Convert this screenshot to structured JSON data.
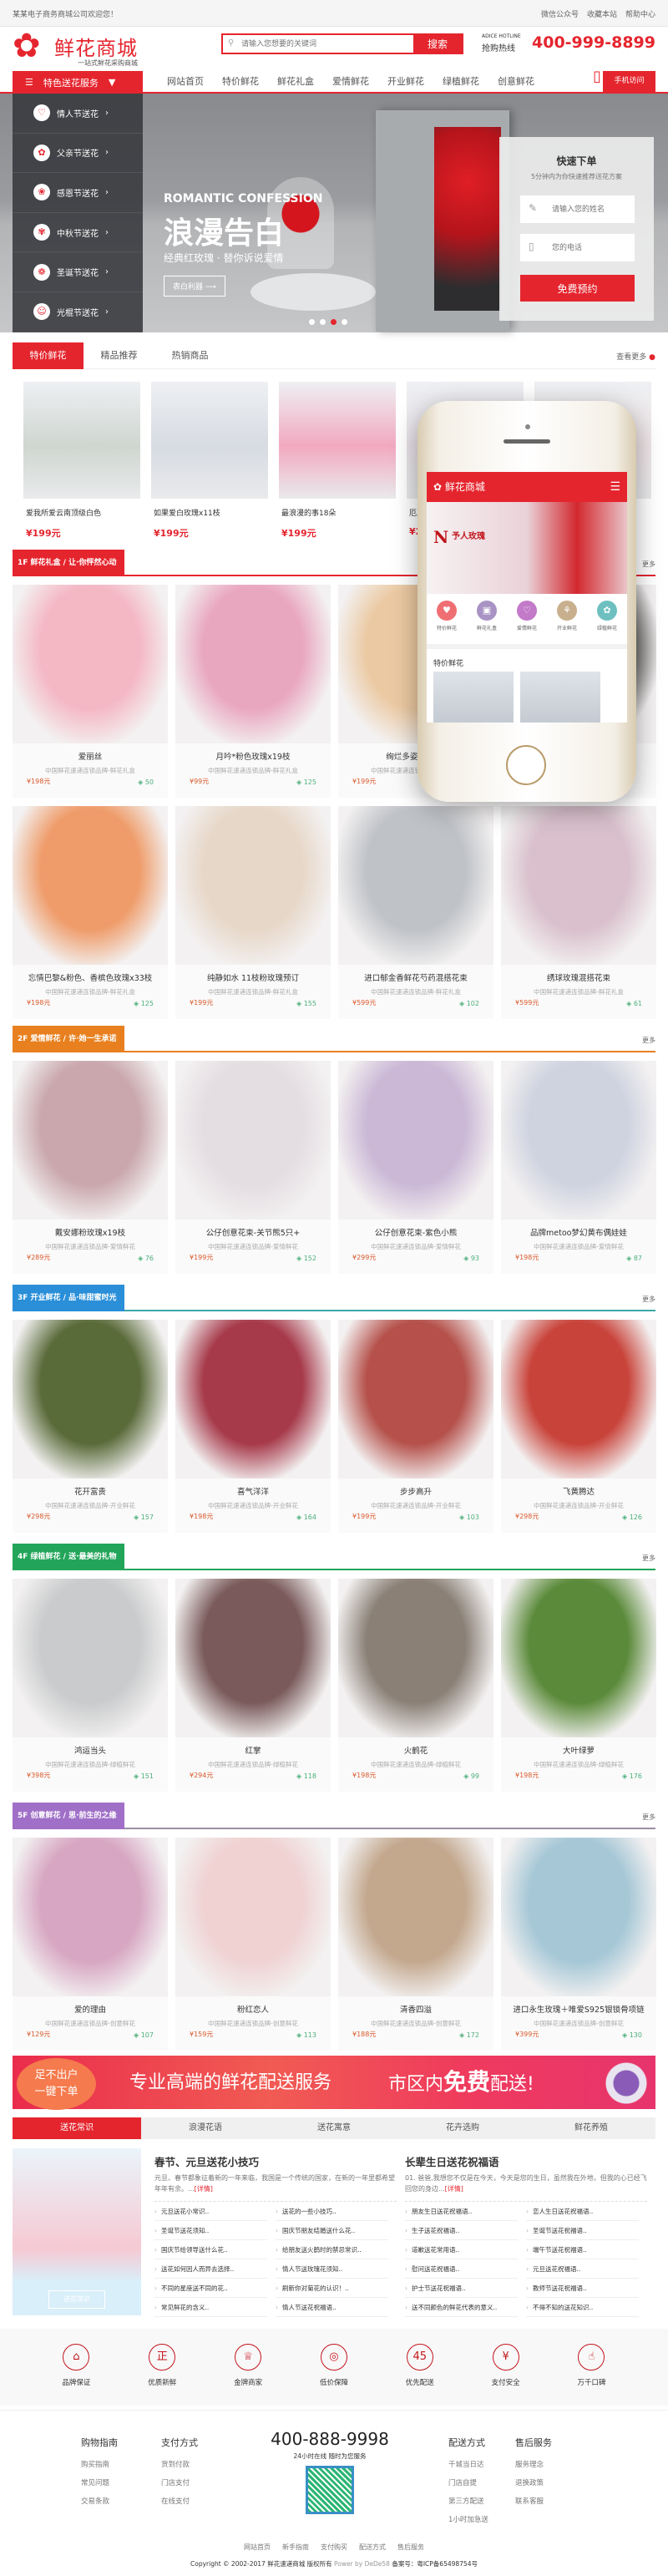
{
  "topbar": {
    "welcome": "某某电子商务商城公司欢迎您！",
    "links": [
      "微信公众号",
      "收藏本站",
      "帮助中心"
    ]
  },
  "header": {
    "logo_name": "鲜花商城",
    "logo_slogan": "一站式鲜花采购商城",
    "search_placeholder": "请输入您想要的关键词",
    "search_button": "搜索",
    "hotline_small": "ADICE HOTLINE",
    "hotline_label": "抢购热线",
    "hotline_number": "400-999-8899"
  },
  "nav": {
    "category_button": "特色送花服务",
    "links": [
      "网站首页",
      "特价鲜花",
      "鲜花礼盒",
      "爱情鲜花",
      "开业鲜花",
      "绿植鲜花",
      "创意鲜花"
    ],
    "mobile": "手机访问"
  },
  "sidebar": {
    "items": [
      "情人节送花",
      "父亲节送花",
      "感恩节送花",
      "中秋节送花",
      "圣诞节送花",
      "光棍节送花"
    ]
  },
  "banner": {
    "en": "ROMANTIC CONFESSION",
    "title": "浪漫告白",
    "subtitle": "经典红玫瑰 · 替你诉说爱情",
    "button": "表白利器 ⟶",
    "active_slide": 3,
    "slides": 4
  },
  "quick_order": {
    "title": "快速下单",
    "desc": "5分钟内为你快速推荐送花方案",
    "name_placeholder": "请输入您的姓名",
    "phone_placeholder": "您的电话",
    "button": "免费预约"
  },
  "tabs": {
    "items": [
      "特价鲜花",
      "精品推荐",
      "热销商品"
    ],
    "active": 0,
    "more": "查看更多"
  },
  "tab_products": [
    {
      "name": "爱我所爱云南顶级白色",
      "price": "¥199元",
      "color": "#cfd6d0"
    },
    {
      "name": "如果爱白玫瑰x11枝",
      "price": "¥199元",
      "color": "#d7dbe2"
    },
    {
      "name": "最浪漫的事18朵",
      "price": "¥199元",
      "color": "#f2a9c0"
    },
    {
      "name": "厄瓜",
      "price": "¥2",
      "color": "#e8e2e8"
    },
    {
      "name": "",
      "price": "",
      "color": "#eee4e6"
    }
  ],
  "floors": [
    {
      "label": "1F 鲜花礼盒 / 让·你怦然心动",
      "more": "更多",
      "color": "#e5252e",
      "line": "#e5252e",
      "items": [
        {
          "name": "爱丽丝",
          "sub": "中国鲜花速递连锁品牌-鲜花礼盒",
          "price": "¥198元",
          "count": "50",
          "color": "#f4b7c4"
        },
        {
          "name": "月吟*粉色玫瑰x19枝",
          "sub": "中国鲜花速递连锁品牌-鲜花礼盒",
          "price": "¥99元",
          "count": "125",
          "color": "#e9a6bf"
        },
        {
          "name": "绚烂多姿*香槟色",
          "sub": "中国鲜花速递连锁品牌-鲜花礼盒",
          "price": "¥199元",
          "count": "",
          "color": "#ebc9a2"
        },
        {
          "name": "",
          "sub": "",
          "price": "",
          "count": "",
          "color": "#4a4a48"
        },
        {
          "name": "忘情巴黎&粉色、香槟色玫瑰x33枝",
          "sub": "中国鲜花速递连锁品牌-鲜花礼盒",
          "price": "¥198元",
          "count": "125",
          "color": "#ef9c6a"
        },
        {
          "name": "纯静如水 11枝粉玫瑰预订",
          "sub": "中国鲜花速递连锁品牌-鲜花礼盒",
          "price": "¥199元",
          "count": "155",
          "color": "#e7d7c8"
        },
        {
          "name": "进口郁金香鲜花芍药混搭花束",
          "sub": "中国鲜花速递连锁品牌-鲜花礼盒",
          "price": "¥599元",
          "count": "102",
          "color": "#bfc2c7"
        },
        {
          "name": "绣球玫瑰混搭花束",
          "sub": "中国鲜花速递连锁品牌-鲜花礼盒",
          "price": "¥599元",
          "count": "61",
          "color": "#d9c0cc"
        }
      ]
    },
    {
      "label": "2F 爱情鲜花 / 许·她一生承诺",
      "more": "更多",
      "color": "#e8801f",
      "line": "#e8801f",
      "items": [
        {
          "name": "戴安娜粉玫瑰x19枝",
          "sub": "中国鲜花速递连锁品牌-爱情鲜花",
          "price": "¥289元",
          "count": "76",
          "color": "#c9a7ad"
        },
        {
          "name": "公仔创意花束-关节熊5只+",
          "sub": "中国鲜花速递连锁品牌-爱情鲜花",
          "price": "¥199元",
          "count": "152",
          "color": "#e4dde2"
        },
        {
          "name": "公仔创意花束-紫色小熊",
          "sub": "中国鲜花速递连锁品牌-爱情鲜花",
          "price": "¥299元",
          "count": "93",
          "color": "#cbb8d6"
        },
        {
          "name": "品牌metoo梦幻黄布偶娃娃",
          "sub": "中国鲜花速递连锁品牌-爱情鲜花",
          "price": "¥198元",
          "count": "87",
          "color": "#cfd3e0"
        }
      ]
    },
    {
      "label": "3F 开业鲜花 / 品·味甜蜜时光",
      "more": "更多",
      "color": "#2a8fd8",
      "line": "#3aa6a6",
      "items": [
        {
          "name": "花开富贵",
          "sub": "中国鲜花速递连锁品牌-开业鲜花",
          "price": "¥298元",
          "count": "157",
          "color": "#5a6b3a"
        },
        {
          "name": "喜气洋洋",
          "sub": "中国鲜花速递连锁品牌-开业鲜花",
          "price": "¥198元",
          "count": "164",
          "color": "#a6394a"
        },
        {
          "name": "步步高升",
          "sub": "中国鲜花速递连锁品牌-开业鲜花",
          "price": "¥199元",
          "count": "103",
          "color": "#b5504a"
        },
        {
          "name": "飞黄腾达",
          "sub": "中国鲜花速递连锁品牌-开业鲜花",
          "price": "¥298元",
          "count": "126",
          "color": "#c8433a"
        }
      ]
    },
    {
      "label": "4F 绿植鲜花 / 送·最美的礼物",
      "more": "更多",
      "color": "#22a55a",
      "line": "#22a55a",
      "items": [
        {
          "name": "鸿运当头",
          "sub": "中国鲜花速递连锁品牌-绿植鲜花",
          "price": "¥398元",
          "count": "151",
          "color": "#c9cbcc"
        },
        {
          "name": "红掌",
          "sub": "中国鲜花速递连锁品牌-绿植鲜花",
          "price": "¥294元",
          "count": "118",
          "color": "#7a5a5a"
        },
        {
          "name": "火鹤花",
          "sub": "中国鲜花速递连锁品牌-绿植鲜花",
          "price": "¥198元",
          "count": "99",
          "color": "#8a8076"
        },
        {
          "name": "大叶绿萝",
          "sub": "中国鲜花速递连锁品牌-绿植鲜花",
          "price": "¥198元",
          "count": "176",
          "color": "#5b8a3a"
        }
      ]
    },
    {
      "label": "5F 创意鲜花 / 思·前生的之缘",
      "more": "更多",
      "color": "#a070c8",
      "line": "#9a8fa8",
      "items": [
        {
          "name": "爱的理由",
          "sub": "中国鲜花速递连锁品牌-创意鲜花",
          "price": "¥129元",
          "count": "107",
          "color": "#d7a6c2"
        },
        {
          "name": "粉红恋人",
          "sub": "中国鲜花速递连锁品牌-创意鲜花",
          "price": "¥159元",
          "count": "113",
          "color": "#f0d2d2"
        },
        {
          "name": "清香四溢",
          "sub": "中国鲜花速递连锁品牌-创意鲜花",
          "price": "¥188元",
          "count": "172",
          "color": "#c3a88e"
        },
        {
          "name": "进口永生玫瑰＋唯爱S925银锁骨项链",
          "sub": "中国鲜花速递连锁品牌-创意鲜花",
          "price": "¥399元",
          "count": "130",
          "color": "#a5c7d6"
        }
      ]
    }
  ],
  "phone": {
    "title": "鲜花商城",
    "banner_a": "N",
    "banner_b": "予人玫瑰",
    "icons": [
      {
        "label": "特价鲜花",
        "color": "#ef6f73"
      },
      {
        "label": "鲜花礼盒",
        "color": "#a993c4"
      },
      {
        "label": "爱情鲜花",
        "color": "#c27ac9"
      },
      {
        "label": "开业鲜花",
        "color": "#c8b08e"
      },
      {
        "label": "绿植鲜花",
        "color": "#6ec0c0"
      }
    ],
    "section": "特价鲜花",
    "products": [
      {
        "name": "爱我所爱云南顶级白色",
        "price": "¥199"
      },
      {
        "name": "如果爱白玫瑰x11枝",
        "price": "¥199"
      }
    ]
  },
  "promo": {
    "badge_l1": "足不出户",
    "badge_l2": "一键下单",
    "text1": "专业高端的鲜花配送服务",
    "text2_a": "市区内",
    "text2_b": "免费",
    "text2_c": "配送!"
  },
  "articles": {
    "tabs": [
      "送花常识",
      "浪漫花语",
      "送花寓意",
      "花卉选购",
      "鲜花养殖"
    ],
    "active": 0,
    "image_button": "送花常识",
    "cols": [
      {
        "title": "春节、元旦送花小技巧",
        "summary": "元旦、春节都象征着新的一年来临，我国是一个传统的国家，在新的一年里都希望年年有余。...",
        "detail": "[详情]",
        "links": [
          "元旦送花小常识..",
          "送花的一些小技巧..",
          "圣诞节送花须知..",
          "国庆节朋友结婚送什么花..",
          "国庆节给领导送什么花..",
          "给朋友送火鹤时的禁忌常识..",
          "送花如何因人而异去选择..",
          "情人节送玫瑰花须知..",
          "不同的星座送不同的花..",
          "刷新你对菊花的认识！..",
          "常见鲜花的含义..",
          "情人节送花祝福语.."
        ]
      },
      {
        "title": "长辈生日送花祝福语",
        "summary": "01. 爸爸,我想您不仅是在今天，今天是您的生日，虽然我在外地，但我的心已经飞回您的身边...",
        "detail": "[详情]",
        "links": [
          "朋友生日送花祝福语..",
          "恋人生日送花祝福语..",
          "生子送花祝福语..",
          "圣诞节送花祝福语..",
          "道歉送花常用语..",
          "端午节送花祝福语..",
          "慰问送花祝福语..",
          "元旦送花祝福语..",
          "护士节送花祝福语..",
          "教师节送花祝福语..",
          "送不同颜色的鲜花代表的意义..",
          "不得不知的送花知识.."
        ]
      }
    ]
  },
  "features": [
    {
      "label": "品牌保证",
      "icon": "store-icon",
      "glyph": "⌂"
    },
    {
      "label": "优质新鲜",
      "icon": "shield-icon",
      "glyph": "正"
    },
    {
      "label": "金牌商家",
      "icon": "trophy-icon",
      "glyph": "♕"
    },
    {
      "label": "低价保障",
      "icon": "globe-icon",
      "glyph": "◎"
    },
    {
      "label": "优先配送",
      "icon": "45-icon",
      "glyph": "45"
    },
    {
      "label": "支付安全",
      "icon": "yen-icon",
      "glyph": "¥"
    },
    {
      "label": "万千口碑",
      "icon": "thumbs-up-icon",
      "glyph": "☝"
    }
  ],
  "footer": {
    "cols": [
      {
        "title": "购物指南",
        "links": [
          "购买指南",
          "常见问题",
          "交易条款"
        ]
      },
      {
        "title": "支付方式",
        "links": [
          "货到付款",
          "门店支付",
          "在线支付"
        ]
      },
      {
        "title": "配送方式",
        "links": [
          "千城当日达",
          "门店自提",
          "第三方配送",
          "1小时加急送"
        ]
      },
      {
        "title": "售后服务",
        "links": [
          "服务理念",
          "退换政策",
          "联系客服"
        ]
      }
    ],
    "phone": "400-888-9998",
    "phone_desc": "24小时在线 随时为您服务",
    "links": [
      "网站首页",
      "新手指南",
      "支付购买",
      "配送方式",
      "售后服务"
    ],
    "copyright": "Copyright © 2002-2017 鲜花速递商城 版权所有",
    "powered": "Power by DeDe58",
    "icp": "备案号：粤ICP备65498754号"
  },
  "colors": {
    "accent": "#e5252e"
  }
}
